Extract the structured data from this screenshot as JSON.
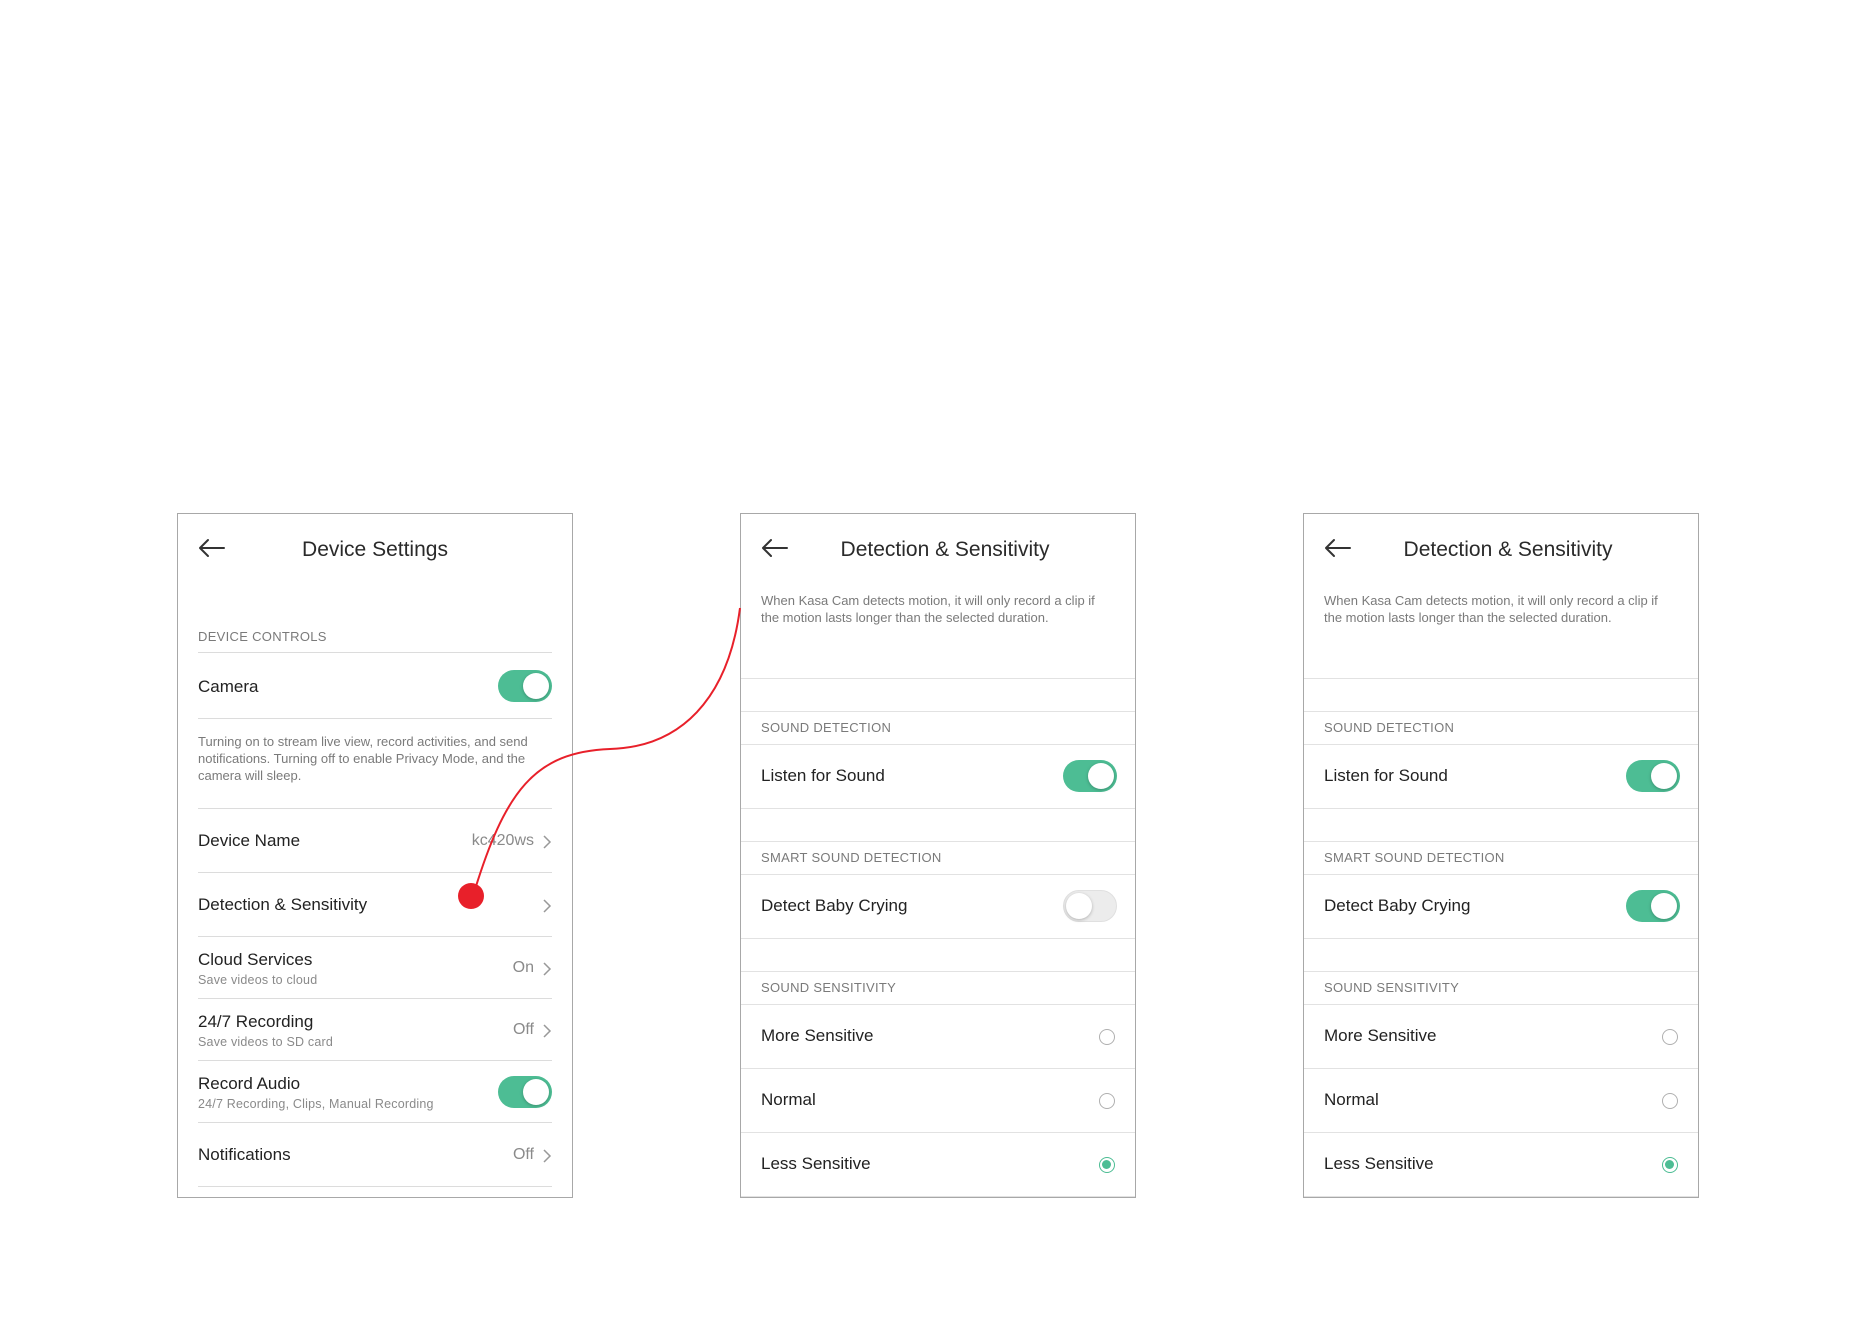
{
  "accent_color": "#4dbd94",
  "annotation_color": "#e8202a",
  "screen1": {
    "title": "Device Settings",
    "section_label": "DEVICE CONTROLS",
    "camera": {
      "label": "Camera",
      "toggle_on": true
    },
    "camera_description": "Turning on to stream live view, record activities, and send notifications. Turning off to enable Privacy Mode, and the camera will sleep.",
    "device_name": {
      "label": "Device Name",
      "value": "kc420ws"
    },
    "detection": {
      "label": "Detection & Sensitivity"
    },
    "cloud": {
      "label": "Cloud Services",
      "sub": "Save videos to cloud",
      "value": "On"
    },
    "recording": {
      "label": "24/7 Recording",
      "sub": "Save videos to SD card",
      "value": "Off"
    },
    "record_audio": {
      "label": "Record Audio",
      "sub": "24/7 Recording, Clips, Manual Recording",
      "toggle_on": true
    },
    "notifications": {
      "label": "Notifications",
      "value": "Off"
    }
  },
  "screen2": {
    "title": "Detection & Sensitivity",
    "description": "When Kasa Cam detects motion, it will only record a clip if the motion lasts longer than the selected duration.",
    "sound_detection_label": "SOUND DETECTION",
    "listen": {
      "label": "Listen for Sound",
      "toggle_on": true
    },
    "smart_label": "SMART SOUND DETECTION",
    "baby": {
      "label": "Detect Baby Crying",
      "toggle_on": false
    },
    "sensitivity_label": "SOUND SENSITIVITY",
    "options": [
      {
        "label": "More Sensitive",
        "selected": false
      },
      {
        "label": "Normal",
        "selected": false
      },
      {
        "label": "Less Sensitive",
        "selected": true
      }
    ]
  },
  "screen3": {
    "title": "Detection & Sensitivity",
    "description": "When Kasa Cam detects motion, it will only record a clip if the motion lasts longer than the selected duration.",
    "sound_detection_label": "SOUND DETECTION",
    "listen": {
      "label": "Listen for Sound",
      "toggle_on": true
    },
    "smart_label": "SMART SOUND DETECTION",
    "baby": {
      "label": "Detect Baby Crying",
      "toggle_on": true
    },
    "sensitivity_label": "SOUND SENSITIVITY",
    "options": [
      {
        "label": "More Sensitive",
        "selected": false
      },
      {
        "label": "Normal",
        "selected": false
      },
      {
        "label": "Less Sensitive",
        "selected": true
      }
    ]
  }
}
